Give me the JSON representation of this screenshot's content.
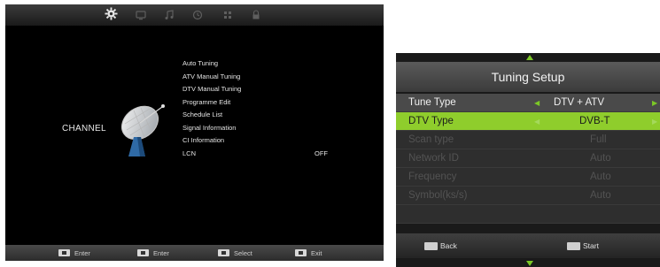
{
  "left_menu": {
    "top_icons": [
      "gear-icon",
      "monitor-icon",
      "music-note-icon",
      "clock-icon",
      "grid-icon",
      "lock-icon"
    ],
    "section_label": "CHANNEL",
    "items": [
      {
        "label": "Auto Tuning",
        "value": ""
      },
      {
        "label": "ATV Manual Tuning",
        "value": ""
      },
      {
        "label": "DTV Manual Tuning",
        "value": ""
      },
      {
        "label": "Programme Edit",
        "value": ""
      },
      {
        "label": "Schedule List",
        "value": ""
      },
      {
        "label": "Signal Information",
        "value": ""
      },
      {
        "label": "CI Information",
        "value": ""
      },
      {
        "label": "LCN",
        "value": "OFF"
      }
    ],
    "footer_hints": [
      {
        "key": "ok-key-icon",
        "label": "Enter"
      },
      {
        "key": "menu-key-icon",
        "label": "Enter"
      },
      {
        "key": "arrow-key-icon",
        "label": "Select"
      },
      {
        "key": "exit-key-icon",
        "label": "Exit"
      }
    ]
  },
  "tuning_setup": {
    "title": "Tuning Setup",
    "rows": [
      {
        "label": "Tune Type",
        "value": "DTV + ATV",
        "state": "normal"
      },
      {
        "label": "DTV Type",
        "value": "DVB-T",
        "state": "selected"
      },
      {
        "label": "Scan type",
        "value": "Full",
        "state": "disabled"
      },
      {
        "label": "Network ID",
        "value": "Auto",
        "state": "disabled"
      },
      {
        "label": "Frequency",
        "value": "Auto",
        "state": "disabled"
      },
      {
        "label": "Symbol(ks/s)",
        "value": "Auto",
        "state": "disabled"
      }
    ],
    "footer": {
      "back_label": "Back",
      "start_label": "Start"
    },
    "accent_color": "#8fcd2c"
  }
}
